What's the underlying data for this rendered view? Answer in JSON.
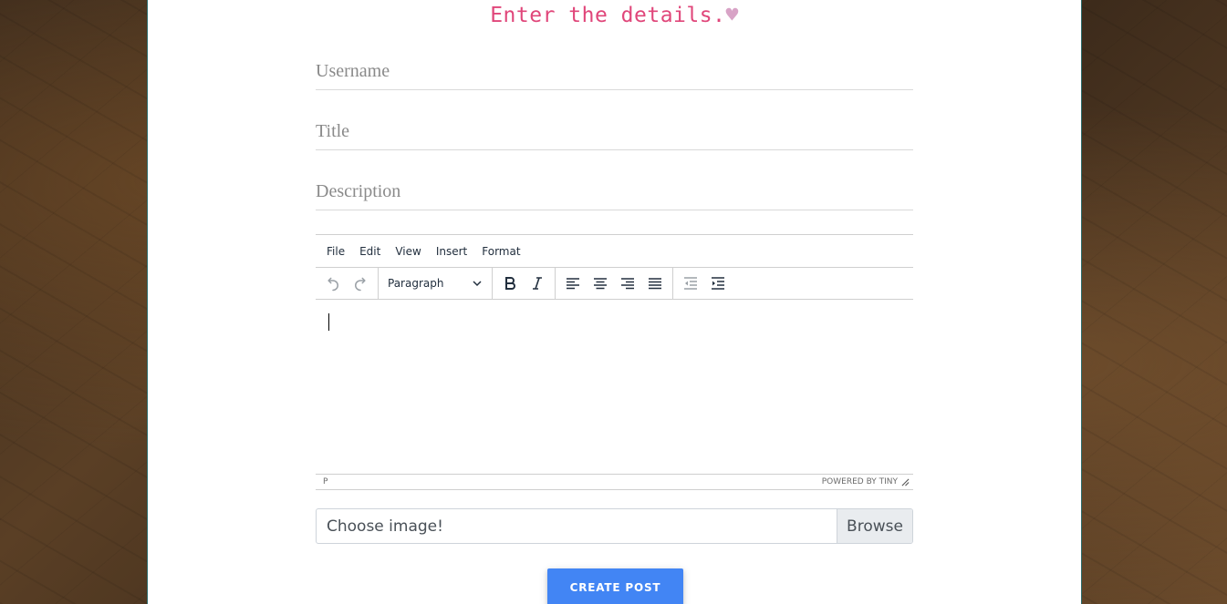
{
  "heading": {
    "text": "Enter the details.",
    "heart": "♥"
  },
  "form": {
    "username_placeholder": "Username",
    "title_placeholder": "Title",
    "description_placeholder": "Description"
  },
  "editor": {
    "menu": [
      "File",
      "Edit",
      "View",
      "Insert",
      "Format"
    ],
    "block_format": "Paragraph",
    "status_path": "P",
    "branding": "POWERED BY TINY"
  },
  "file_input": {
    "label": "Choose image!",
    "browse_label": "Browse"
  },
  "submit_label": "CREATE POST"
}
